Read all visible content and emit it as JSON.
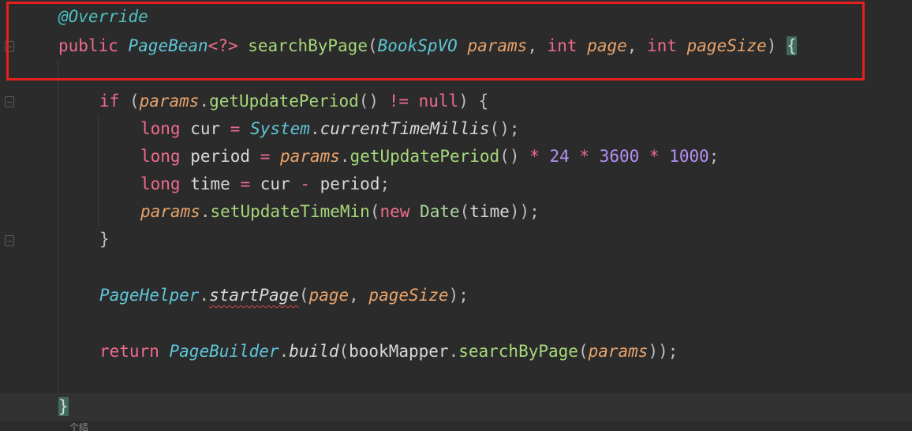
{
  "editor": {
    "lines": [
      {
        "tokens": [
          {
            "t": "@Override",
            "c": "ann"
          }
        ]
      },
      {
        "tokens": [
          {
            "t": "public ",
            "c": "kw"
          },
          {
            "t": "PageBean",
            "c": "type"
          },
          {
            "t": "<?>",
            "c": "kw"
          },
          {
            "t": " searchByPage",
            "c": "fn"
          },
          {
            "t": "(",
            "c": "punc"
          },
          {
            "t": "BookSpVO",
            "c": "type"
          },
          {
            "t": " params",
            "c": "param"
          },
          {
            "t": ", ",
            "c": "punc"
          },
          {
            "t": "int",
            "c": "kw"
          },
          {
            "t": " page",
            "c": "param"
          },
          {
            "t": ", ",
            "c": "punc"
          },
          {
            "t": "int",
            "c": "kw"
          },
          {
            "t": " pageSize",
            "c": "param"
          },
          {
            "t": ") ",
            "c": "punc"
          },
          {
            "t": "{",
            "c": "brace-hl"
          }
        ]
      },
      {
        "tokens": []
      },
      {
        "tokens": [
          {
            "t": "if ",
            "c": "kw"
          },
          {
            "t": "(",
            "c": "punc"
          },
          {
            "t": "params",
            "c": "param"
          },
          {
            "t": ".",
            "c": "punc"
          },
          {
            "t": "getUpdatePeriod",
            "c": "fn"
          },
          {
            "t": "() ",
            "c": "punc"
          },
          {
            "t": "!=",
            "c": "op"
          },
          {
            "t": " null",
            "c": "kw"
          },
          {
            "t": ") {",
            "c": "punc"
          }
        ]
      },
      {
        "tokens": [
          {
            "t": "long ",
            "c": "kw"
          },
          {
            "t": "cur ",
            "c": "var"
          },
          {
            "t": "= ",
            "c": "op"
          },
          {
            "t": "System",
            "c": "static-field"
          },
          {
            "t": ".",
            "c": "punc"
          },
          {
            "t": "currentTimeMillis",
            "c": "fn-i"
          },
          {
            "t": "();",
            "c": "punc"
          }
        ]
      },
      {
        "tokens": [
          {
            "t": "long ",
            "c": "kw"
          },
          {
            "t": "period ",
            "c": "var"
          },
          {
            "t": "= ",
            "c": "op"
          },
          {
            "t": "params",
            "c": "param"
          },
          {
            "t": ".",
            "c": "punc"
          },
          {
            "t": "getUpdatePeriod",
            "c": "fn"
          },
          {
            "t": "() ",
            "c": "punc"
          },
          {
            "t": "* ",
            "c": "op"
          },
          {
            "t": "24 ",
            "c": "num"
          },
          {
            "t": "* ",
            "c": "op"
          },
          {
            "t": "3600 ",
            "c": "num"
          },
          {
            "t": "* ",
            "c": "op"
          },
          {
            "t": "1000",
            "c": "num"
          },
          {
            "t": ";",
            "c": "punc"
          }
        ]
      },
      {
        "tokens": [
          {
            "t": "long ",
            "c": "kw"
          },
          {
            "t": "time ",
            "c": "var"
          },
          {
            "t": "= ",
            "c": "op"
          },
          {
            "t": "cur ",
            "c": "var"
          },
          {
            "t": "- ",
            "c": "op"
          },
          {
            "t": "period",
            "c": "var"
          },
          {
            "t": ";",
            "c": "punc"
          }
        ]
      },
      {
        "tokens": [
          {
            "t": "params",
            "c": "param"
          },
          {
            "t": ".",
            "c": "punc"
          },
          {
            "t": "setUpdateTimeMin",
            "c": "fn"
          },
          {
            "t": "(",
            "c": "punc"
          },
          {
            "t": "new ",
            "c": "kw"
          },
          {
            "t": "Date",
            "c": "type-plain"
          },
          {
            "t": "(",
            "c": "punc"
          },
          {
            "t": "time",
            "c": "var"
          },
          {
            "t": "));",
            "c": "punc"
          }
        ]
      },
      {
        "tokens": [
          {
            "t": "}",
            "c": "punc"
          }
        ]
      },
      {
        "tokens": []
      },
      {
        "tokens": [
          {
            "t": "PageHelper",
            "c": "type"
          },
          {
            "t": ".",
            "c": "punc"
          },
          {
            "t": "startPage",
            "c": "fn-i squiggle"
          },
          {
            "t": "(",
            "c": "punc"
          },
          {
            "t": "page",
            "c": "param"
          },
          {
            "t": ", ",
            "c": "punc"
          },
          {
            "t": "pageSize",
            "c": "param"
          },
          {
            "t": ");",
            "c": "punc"
          }
        ]
      },
      {
        "tokens": []
      },
      {
        "tokens": [
          {
            "t": "return ",
            "c": "kw"
          },
          {
            "t": "PageBuilder",
            "c": "type"
          },
          {
            "t": ".",
            "c": "punc"
          },
          {
            "t": "build",
            "c": "fn-i"
          },
          {
            "t": "(",
            "c": "punc"
          },
          {
            "t": "bookMapper",
            "c": "var"
          },
          {
            "t": ".",
            "c": "punc"
          },
          {
            "t": "searchByPage",
            "c": "fn"
          },
          {
            "t": "(",
            "c": "punc"
          },
          {
            "t": "params",
            "c": "param"
          },
          {
            "t": "));",
            "c": "punc"
          }
        ]
      },
      {
        "tokens": []
      },
      {
        "tokens": [
          {
            "t": "}",
            "c": "brace-hl"
          }
        ]
      }
    ],
    "bottom_peek": "个结"
  }
}
